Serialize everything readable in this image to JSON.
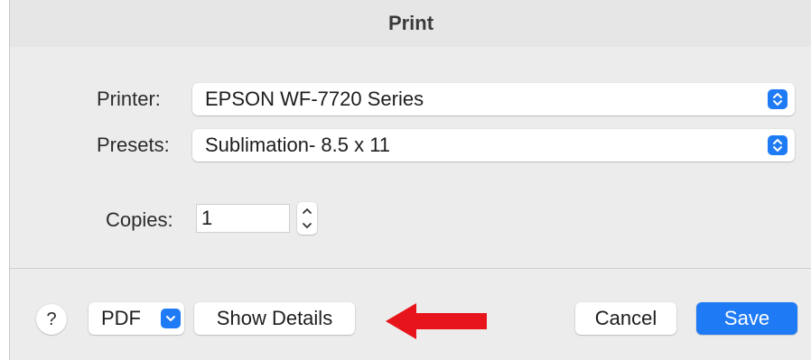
{
  "dialog": {
    "title": "Print"
  },
  "printer": {
    "label": "Printer:",
    "value": "EPSON WF-7720 Series"
  },
  "presets": {
    "label": "Presets:",
    "value": "Sublimation- 8.5 x 11"
  },
  "copies": {
    "label": "Copies:",
    "value": "1"
  },
  "footer": {
    "help_label": "?",
    "pdf_label": "PDF",
    "show_details_label": "Show Details",
    "cancel_label": "Cancel",
    "save_label": "Save"
  },
  "annotation": {
    "arrow_color": "#e8141b"
  },
  "colors": {
    "accent": "#1f7bf5"
  }
}
